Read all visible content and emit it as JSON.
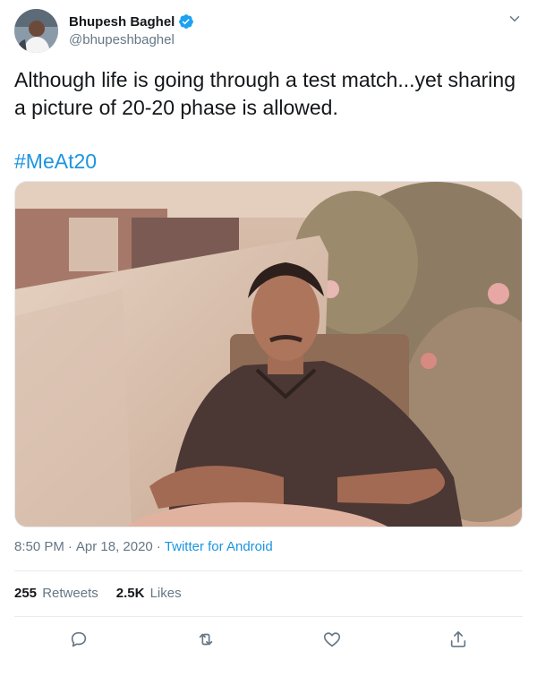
{
  "author": {
    "display_name": "Bhupesh Baghel",
    "handle": "@bhupeshbaghel",
    "verified": true
  },
  "tweet": {
    "text": "Although life is going through a test match...yet sharing a picture of 20-20 phase is allowed.",
    "hashtag": "#MeAt20"
  },
  "meta": {
    "time": "8:50 PM",
    "separator1": "·",
    "date": "Apr 18, 2020",
    "separator2": "·",
    "source": "Twitter for Android"
  },
  "stats": {
    "retweets_count": "255",
    "retweets_label": "Retweets",
    "likes_count": "2.5K",
    "likes_label": "Likes"
  },
  "icons": {
    "reply": "reply-icon",
    "retweet": "retweet-icon",
    "like": "heart-icon",
    "share": "share-icon",
    "more": "chevron-down-icon",
    "verified": "verified-badge-icon"
  },
  "colors": {
    "link": "#1b95e0",
    "secondary_text": "#657786",
    "primary_text": "#14171a",
    "divider": "#e6ecf0"
  }
}
